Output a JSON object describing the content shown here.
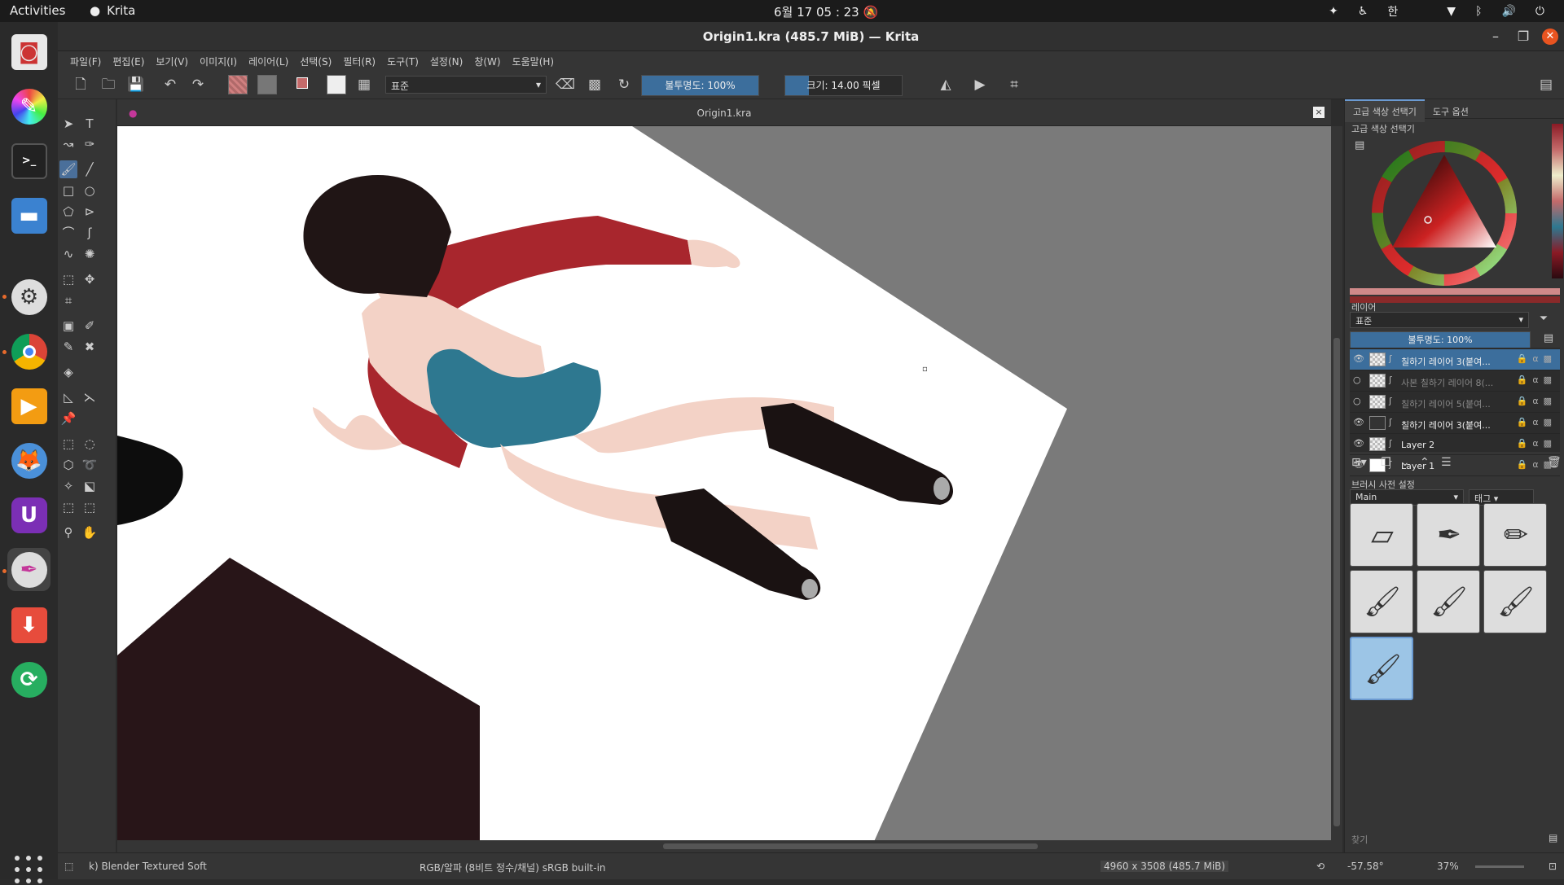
{
  "system": {
    "activities": "Activities",
    "app_name": "Krita",
    "clock": "6월 17 05 : 23",
    "input_method": "한"
  },
  "window": {
    "title": "Origin1.kra (485.7 MiB) — Krita"
  },
  "menu": [
    "파일(F)",
    "편집(E)",
    "보기(V)",
    "이미지(I)",
    "레이어(L)",
    "선택(S)",
    "필터(R)",
    "도구(T)",
    "설정(N)",
    "창(W)",
    "도움말(H)"
  ],
  "toolbar": {
    "blend_mode": "표준",
    "opacity_label": "불투명도: 100%",
    "opacity": 1.0,
    "size_label": "크기: 14.00 픽셀",
    "size_fraction": 0.2,
    "fg_color": "#c46a6a",
    "bg_color": "#888888"
  },
  "canvas": {
    "tab_title": "Origin1.kra",
    "close": "×"
  },
  "dockers": {
    "tabs": [
      "고급 색상 선택기",
      "도구 옵션"
    ],
    "color_selector_title": "고급 색상 선택기",
    "layers_title": "레이어",
    "layers_blend": "표준",
    "layers_opacity_label": "불투명도:  100%",
    "layers": [
      {
        "name": "칠하기 레이어 3(붙여...",
        "visible": true,
        "selected": true,
        "thumb": "check"
      },
      {
        "name": "사본 칠하기 레이어 8(...",
        "visible": false,
        "selected": false,
        "thumb": "check"
      },
      {
        "name": "칠하기 레이어 5(붙여...",
        "visible": false,
        "selected": false,
        "thumb": "check"
      },
      {
        "name": "칠하기 레이어 3(붙여...",
        "visible": true,
        "selected": false,
        "thumb": "dark"
      },
      {
        "name": "Layer 2",
        "visible": true,
        "selected": false,
        "thumb": "check"
      },
      {
        "name": "Layer 1",
        "visible": true,
        "selected": false,
        "thumb": "white"
      }
    ],
    "presets_title": "브러시 사전 설정",
    "presets_tag": "Main",
    "presets_tag_btn": "태그",
    "search_placeholder": "찾기"
  },
  "status": {
    "brush": "k) Blender Textured Soft",
    "color_space": "RGB/알파 (8비트 정수/채널)  sRGB built-in",
    "dimensions": "4960 x 3508 (485.7 MiB)",
    "rotation": "-57.58°",
    "zoom": "37%"
  },
  "colors": {
    "accent": "#3c6e9c",
    "canvas_bg": "#7a7a7a",
    "jacket": "#a8262d",
    "leotard": "#2e7890",
    "hair": "#201515",
    "skin": "#f3d2c6"
  }
}
